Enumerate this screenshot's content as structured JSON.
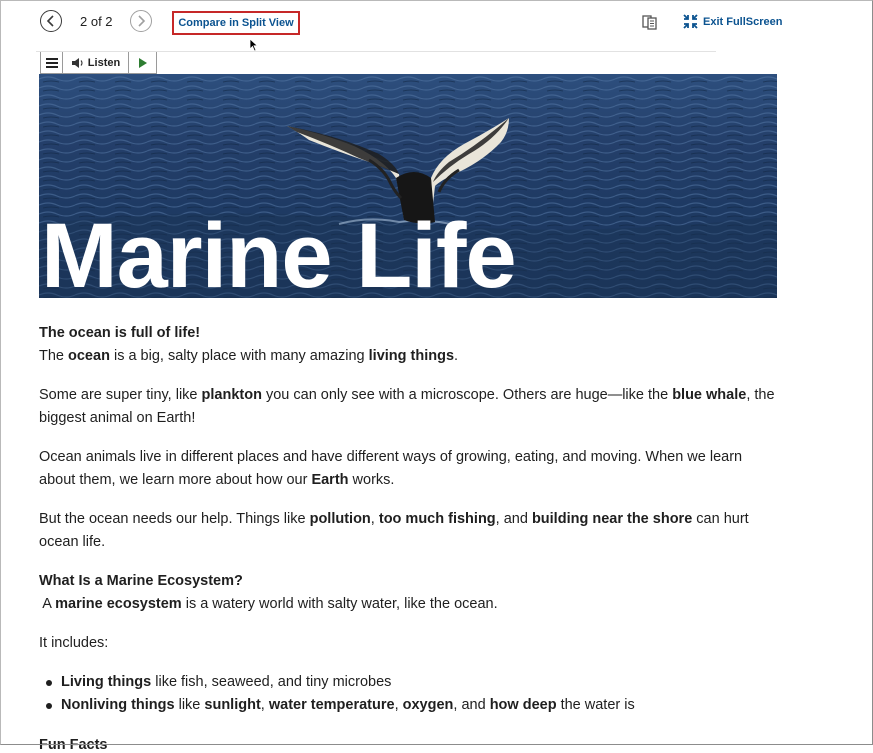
{
  "toolbar": {
    "page_indicator": "2 of 2",
    "compare_label": "Compare in Split View",
    "exit_fullscreen_label": "Exit FullScreen"
  },
  "listen_bar": {
    "listen_label": "Listen"
  },
  "banner": {
    "title": "Marine Life"
  },
  "article": {
    "p1": {
      "heading": "The ocean is full of life!",
      "t1": "The ",
      "b1": "ocean",
      "t2": " is a big, salty place with many amazing ",
      "b2": "living things",
      "t3": "."
    },
    "p2": {
      "t1": "Some are super tiny, like ",
      "b1": "plankton",
      "t2": " you can only see with a microscope. Others are huge—like the ",
      "b2": "blue whale",
      "t3": ", the biggest animal on Earth!"
    },
    "p3": {
      "t1": "Ocean animals live in different places and have different ways of growing, eating, and moving. When we learn about them, we learn more about how our ",
      "b1": "Earth",
      "t2": " works."
    },
    "p4": {
      "t1": "But the ocean needs our help. Things like ",
      "b1": "pollution",
      "t2": ", ",
      "b2": "too much fishing",
      "t3": ", and ",
      "b3": "building near the shore",
      "t4": " can hurt ocean life."
    },
    "p5": {
      "heading": "What Is a Marine Ecosystem?",
      "t1": " A ",
      "b1": "marine ecosystem",
      "t2": " is a watery world with salty water, like the ocean."
    },
    "p6": {
      "text": "It includes:"
    },
    "bullets": [
      {
        "b1": "Living things",
        "t1": " like fish, seaweed, and tiny microbes"
      },
      {
        "b1": "Nonliving things",
        "t1": " like ",
        "b2": "sunlight",
        "t2": ", ",
        "b3": "water temperature",
        "t3": ", ",
        "b4": "oxygen",
        "t4": ", and ",
        "b5": "how deep",
        "t5": " the water is"
      }
    ],
    "cut_off_heading": "Fun Facts"
  },
  "colors": {
    "link_blue": "#0b5390",
    "highlight_red": "#c62828",
    "play_green": "#2e7d32"
  },
  "icons": [
    "chevron-left-icon",
    "chevron-right-icon",
    "mouse-cursor-icon",
    "reading-view-icon",
    "exit-fullscreen-icon",
    "menu-icon",
    "speaker-icon",
    "play-icon"
  ]
}
